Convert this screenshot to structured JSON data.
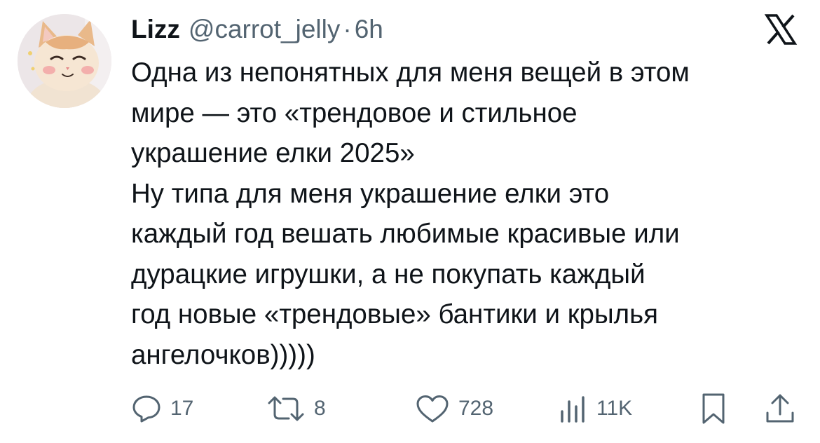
{
  "author": {
    "name": "Lizz",
    "handle": "@carrot_jelly",
    "separator": "·",
    "time": "6h"
  },
  "tweet": {
    "lines": [
      "Одна из непонятных для меня вещей в этом",
      "мире — это «трендовое и стильное",
      "украшение елки 2025»",
      "Ну типа для меня украшение елки это",
      "каждый год вешать любимые красивые или",
      "дурацкие игрушки, а не покупать каждый",
      "год новые «трендовые» бантики и крылья",
      "ангелочков)))))"
    ]
  },
  "actions": {
    "replies": "17",
    "reposts": "8",
    "likes": "728",
    "views": "11K"
  },
  "icons": {
    "platform": "x-logo-icon",
    "reply": "speech-bubble-icon",
    "repost": "repost-arrows-icon",
    "like": "heart-icon",
    "views": "bar-chart-icon",
    "bookmark": "bookmark-icon",
    "share": "share-upload-icon"
  },
  "colors": {
    "text": "#0f1419",
    "secondary": "#536471",
    "background": "#ffffff"
  }
}
